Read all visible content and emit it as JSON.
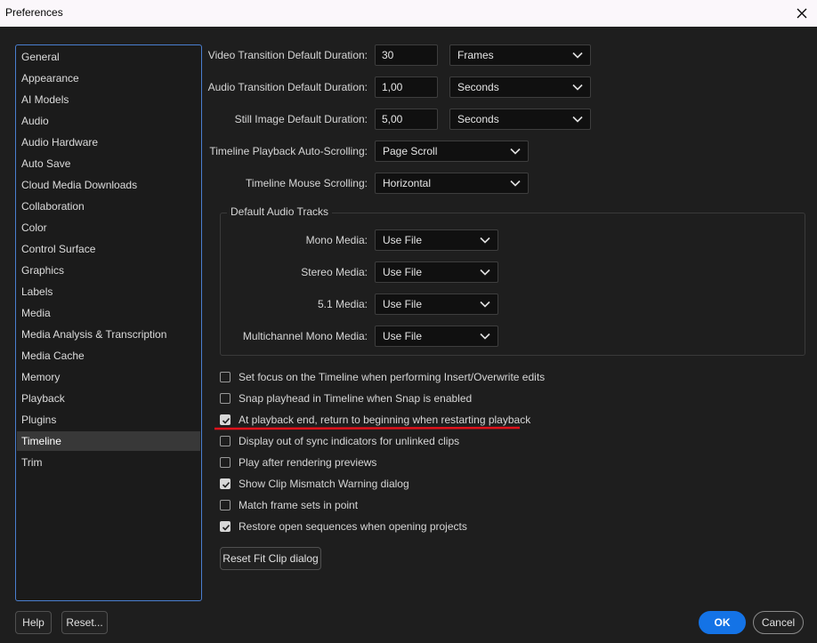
{
  "window": {
    "title": "Preferences"
  },
  "sidebar": {
    "items": [
      {
        "label": "General"
      },
      {
        "label": "Appearance"
      },
      {
        "label": "AI Models"
      },
      {
        "label": "Audio"
      },
      {
        "label": "Audio Hardware"
      },
      {
        "label": "Auto Save"
      },
      {
        "label": "Cloud Media Downloads"
      },
      {
        "label": "Collaboration"
      },
      {
        "label": "Color"
      },
      {
        "label": "Control Surface"
      },
      {
        "label": "Graphics"
      },
      {
        "label": "Labels"
      },
      {
        "label": "Media"
      },
      {
        "label": "Media Analysis & Transcription"
      },
      {
        "label": "Media Cache"
      },
      {
        "label": "Memory"
      },
      {
        "label": "Playback"
      },
      {
        "label": "Plugins"
      },
      {
        "label": "Timeline"
      },
      {
        "label": "Trim"
      }
    ],
    "selected": "Timeline"
  },
  "settings": {
    "video_transition": {
      "label": "Video Transition Default Duration:",
      "value": "30",
      "unit": "Frames"
    },
    "audio_transition": {
      "label": "Audio Transition Default Duration:",
      "value": "1,00",
      "unit": "Seconds"
    },
    "still_image": {
      "label": "Still Image Default Duration:",
      "value": "5,00",
      "unit": "Seconds"
    },
    "autoscroll": {
      "label": "Timeline Playback Auto-Scrolling:",
      "value": "Page Scroll"
    },
    "mouse_scroll": {
      "label": "Timeline Mouse Scrolling:",
      "value": "Horizontal"
    }
  },
  "audio_tracks": {
    "title": "Default Audio Tracks",
    "mono": {
      "label": "Mono Media:",
      "value": "Use File"
    },
    "stereo": {
      "label": "Stereo Media:",
      "value": "Use File"
    },
    "five_one": {
      "label": "5.1 Media:",
      "value": "Use File"
    },
    "multichannel": {
      "label": "Multichannel Mono Media:",
      "value": "Use File"
    }
  },
  "checkboxes": [
    {
      "label": "Set focus on the Timeline when performing Insert/Overwrite edits",
      "checked": false
    },
    {
      "label": "Snap playhead in Timeline when Snap is enabled",
      "checked": false
    },
    {
      "label": "At playback end, return to beginning when restarting playback",
      "checked": true
    },
    {
      "label": "Display out of sync indicators for unlinked clips",
      "checked": false
    },
    {
      "label": "Play after rendering previews",
      "checked": false
    },
    {
      "label": "Show Clip Mismatch Warning dialog",
      "checked": true
    },
    {
      "label": "Match frame sets in point",
      "checked": false
    },
    {
      "label": "Restore open sequences when opening projects",
      "checked": true
    }
  ],
  "buttons": {
    "reset_fit_clip": "Reset Fit Clip dialog",
    "help": "Help",
    "reset": "Reset...",
    "ok": "OK",
    "cancel": "Cancel"
  },
  "colors": {
    "accent": "#1473e6",
    "annotation": "#e0121b",
    "selection_border": "#4a7fd0"
  },
  "icons": {
    "close": "close-icon",
    "dropdown": "chevron-down-icon",
    "check": "check-icon"
  }
}
